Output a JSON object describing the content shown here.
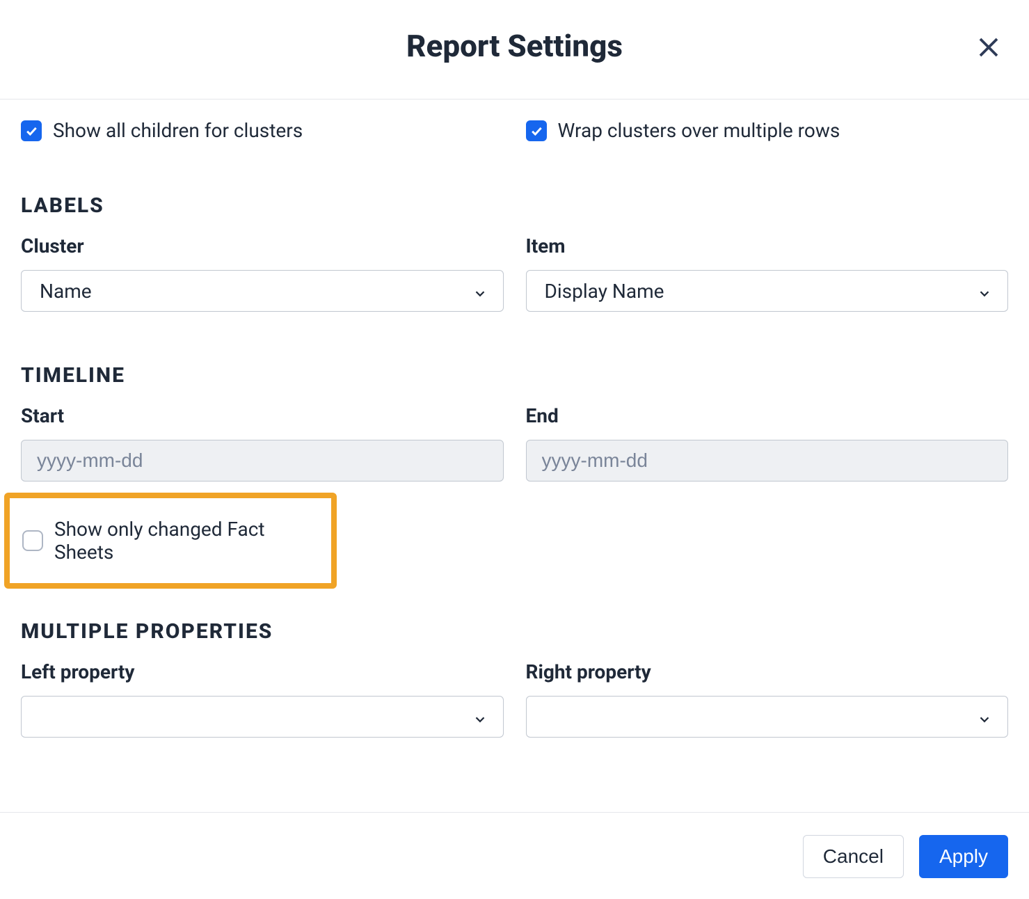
{
  "modal": {
    "title": "Report Settings"
  },
  "top_options": {
    "show_all_children": {
      "label": "Show all children for clusters",
      "checked": true
    },
    "wrap_clusters": {
      "label": "Wrap clusters over multiple rows",
      "checked": true
    }
  },
  "sections": {
    "labels": {
      "heading": "LABELS",
      "cluster": {
        "label": "Cluster",
        "value": "Name"
      },
      "item": {
        "label": "Item",
        "value": "Display Name"
      }
    },
    "timeline": {
      "heading": "TIMELINE",
      "start": {
        "label": "Start",
        "placeholder": "yyyy-mm-dd",
        "value": ""
      },
      "end": {
        "label": "End",
        "placeholder": "yyyy-mm-dd",
        "value": ""
      },
      "show_only_changed": {
        "label": "Show only changed Fact Sheets",
        "checked": false
      }
    },
    "multiple_properties": {
      "heading": "MULTIPLE PROPERTIES",
      "left": {
        "label": "Left property",
        "value": ""
      },
      "right": {
        "label": "Right property",
        "value": ""
      }
    }
  },
  "footer": {
    "cancel": "Cancel",
    "apply": "Apply"
  }
}
